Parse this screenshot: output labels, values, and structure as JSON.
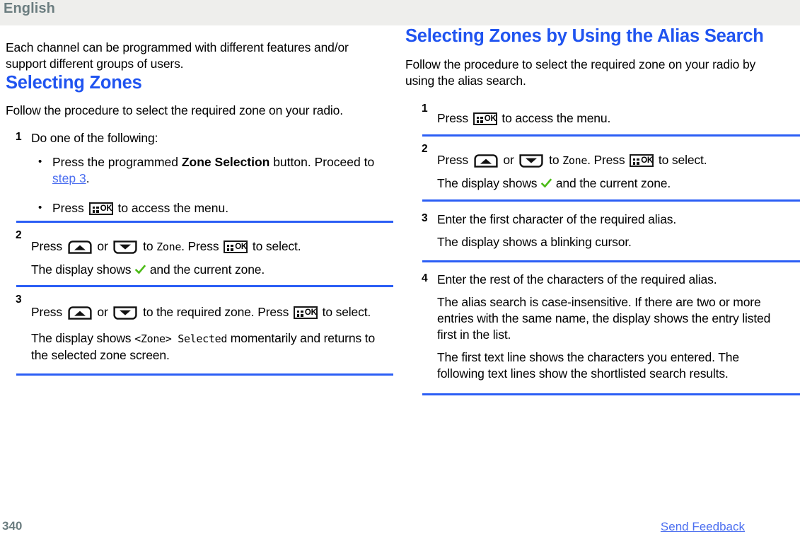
{
  "header": {
    "language": "English"
  },
  "footer": {
    "page_number": "340",
    "send_feedback_label": "Send Feedback"
  },
  "colors": {
    "heading_blue": "#2054f0",
    "link_blue": "#4c6ff0",
    "divider_blue": "#2b5ef5",
    "header_band": "#eeeeec",
    "header_text": "#6b7d80",
    "check_green": "#4cbb17"
  },
  "left_column": {
    "intro": "Each channel can be programmed with different features and/or support different groups of users.",
    "section_title": "Selecting Zones",
    "section_intro": "Follow the procedure to select the required zone on your radio.",
    "steps": [
      {
        "number": "1",
        "text": "Do one of the following:",
        "bullets": [
          {
            "parts": [
              {
                "type": "text",
                "value": "Press the programmed "
              },
              {
                "type": "bold",
                "value": "Zone Selection"
              },
              {
                "type": "text",
                "value": " button. Proceed to "
              },
              {
                "type": "link",
                "value": "step 3"
              },
              {
                "type": "text",
                "value": "."
              }
            ]
          },
          {
            "parts": [
              {
                "type": "text",
                "value": "Press "
              },
              {
                "type": "icon",
                "value": "ok-key-icon"
              },
              {
                "type": "text",
                "value": " to access the menu."
              }
            ]
          }
        ]
      },
      {
        "number": "2",
        "lines": [
          {
            "parts": [
              {
                "type": "text",
                "value": "Press "
              },
              {
                "type": "icon",
                "value": "up-arrow-key-icon"
              },
              {
                "type": "text",
                "value": " or "
              },
              {
                "type": "icon",
                "value": "down-arrow-key-icon"
              },
              {
                "type": "text",
                "value": " to "
              },
              {
                "type": "mono",
                "value": "Zone"
              },
              {
                "type": "text",
                "value": ". Press "
              },
              {
                "type": "icon",
                "value": "ok-key-icon"
              },
              {
                "type": "text",
                "value": " to select."
              }
            ]
          },
          {
            "parts": [
              {
                "type": "text",
                "value": "The display shows "
              },
              {
                "type": "icon",
                "value": "check-icon"
              },
              {
                "type": "text",
                "value": " and the current zone."
              }
            ]
          }
        ]
      },
      {
        "number": "3",
        "lines": [
          {
            "parts": [
              {
                "type": "text",
                "value": "Press "
              },
              {
                "type": "icon",
                "value": "up-arrow-key-icon"
              },
              {
                "type": "text",
                "value": " or "
              },
              {
                "type": "icon",
                "value": "down-arrow-key-icon"
              },
              {
                "type": "text",
                "value": " to the required zone. Press "
              },
              {
                "type": "icon",
                "value": "ok-key-icon"
              },
              {
                "type": "text",
                "value": " to select."
              }
            ]
          },
          {
            "parts": [
              {
                "type": "text",
                "value": "The display shows "
              },
              {
                "type": "mono",
                "value": "<Zone> Selected"
              },
              {
                "type": "text",
                "value": " momentarily and returns to the selected zone screen."
              }
            ]
          }
        ]
      }
    ]
  },
  "right_column": {
    "section_title": "Selecting Zones by Using the Alias Search",
    "section_intro": "Follow the procedure to select the required zone on your radio by using the alias search.",
    "steps": [
      {
        "number": "1",
        "lines": [
          {
            "parts": [
              {
                "type": "text",
                "value": "Press "
              },
              {
                "type": "icon",
                "value": "ok-key-icon"
              },
              {
                "type": "text",
                "value": " to access the menu."
              }
            ]
          }
        ]
      },
      {
        "number": "2",
        "lines": [
          {
            "parts": [
              {
                "type": "text",
                "value": "Press "
              },
              {
                "type": "icon",
                "value": "up-arrow-key-icon"
              },
              {
                "type": "text",
                "value": " or "
              },
              {
                "type": "icon",
                "value": "down-arrow-key-icon"
              },
              {
                "type": "text",
                "value": " to "
              },
              {
                "type": "mono",
                "value": "Zone"
              },
              {
                "type": "text",
                "value": ". Press "
              },
              {
                "type": "icon",
                "value": "ok-key-icon"
              },
              {
                "type": "text",
                "value": " to select."
              }
            ]
          },
          {
            "parts": [
              {
                "type": "text",
                "value": "The display shows "
              },
              {
                "type": "icon",
                "value": "check-icon"
              },
              {
                "type": "text",
                "value": " and the current zone."
              }
            ]
          }
        ]
      },
      {
        "number": "3",
        "lines": [
          {
            "parts": [
              {
                "type": "text",
                "value": "Enter the first character of the required alias."
              }
            ]
          },
          {
            "parts": [
              {
                "type": "text",
                "value": "The display shows a blinking cursor."
              }
            ]
          }
        ]
      },
      {
        "number": "4",
        "lines": [
          {
            "parts": [
              {
                "type": "text",
                "value": "Enter the rest of the characters of the required alias."
              }
            ]
          },
          {
            "parts": [
              {
                "type": "text",
                "value": "The alias search is case-insensitive. If there are two or more entries with the same name, the display shows the entry listed first in the list."
              }
            ]
          },
          {
            "parts": [
              {
                "type": "text",
                "value": "The first text line shows the characters you entered. The following text lines show the shortlisted search results."
              }
            ]
          }
        ]
      }
    ]
  }
}
